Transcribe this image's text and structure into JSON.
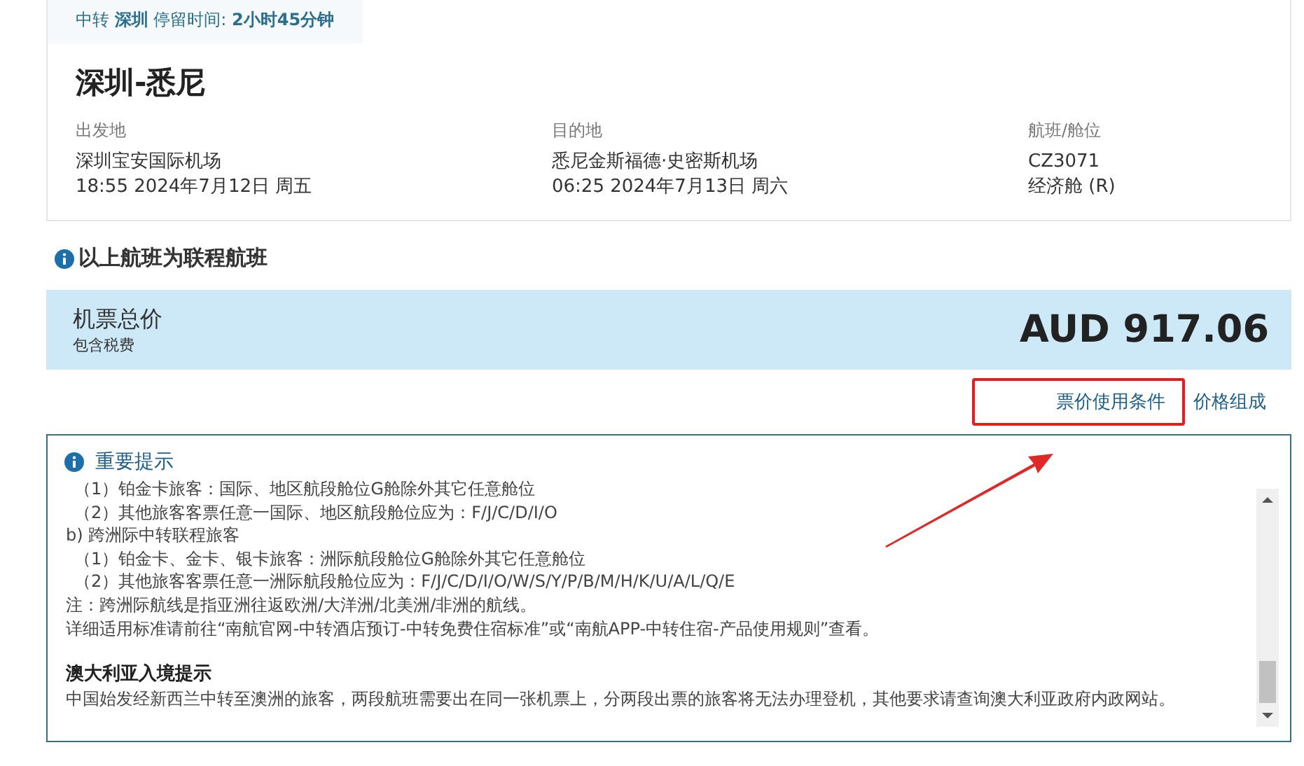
{
  "flight_card": {
    "transfer_note": "中转 **深圳** 停留时间: **2小时45分钟**",
    "route": "深圳-悉尼",
    "columns": [
      {
        "label": "出发地",
        "lines": [
          "深圳宝安国际机场",
          "18:55 2024年7月12日 周五"
        ]
      },
      {
        "label": "目的地",
        "lines": [
          "悉尼金斯福德·史密斯机场",
          "06:25 2024年7月13日 周六"
        ]
      },
      {
        "label": "航班/舱位",
        "lines": [
          "CZ3071",
          "经济舱 (R)"
        ]
      }
    ]
  },
  "connecting_notice": "以上航班为联程航班",
  "price_bar": {
    "title": "机票总价",
    "subtitle": "包含税费",
    "amount": "AUD 917.06"
  },
  "links": [
    {
      "label": "票价使用条件",
      "highlighted": true
    },
    {
      "label": "价格组成",
      "highlighted": false
    }
  ],
  "notice": {
    "title": "重要提示",
    "lines": [
      {
        "kind": "item",
        "text": "（1）铂金卡旅客：国际、地区航段舱位G舱除外其它任意舱位"
      },
      {
        "kind": "item",
        "text": "（2）其他旅客客票任意一国际、地区航段舱位应为：F/J/C/D/I/O"
      },
      {
        "kind": "text",
        "text": "b) 跨洲际中转联程旅客"
      },
      {
        "kind": "item",
        "text": "（1）铂金卡、金卡、银卡旅客：洲际航段舱位G舱除外其它任意舱位"
      },
      {
        "kind": "item",
        "text": "（2）其他旅客客票任意一洲际航段舱位应为：F/J/C/D/I/O/W/S/Y/P/B/M/H/K/U/A/L/Q/E"
      },
      {
        "kind": "text",
        "text": "注：跨洲际航线是指亚洲往返欧洲/大洋洲/北美洲/非洲的航线。"
      },
      {
        "kind": "text",
        "text": "详细适用标准请前往“南航官网-中转酒店预订-中转免费住宿标准”或“南航APP-中转住宿-产品使用规则”查看。"
      },
      {
        "kind": "heading",
        "text": "澳大利亚入境提示"
      },
      {
        "kind": "text",
        "text": "中国始发经新西兰中转至澳洲的旅客，两段航班需要出在同一张机票上，分两段出票的旅客将无法办理登机，其他要求请查询澳大利亚政府内政网站。"
      }
    ]
  }
}
